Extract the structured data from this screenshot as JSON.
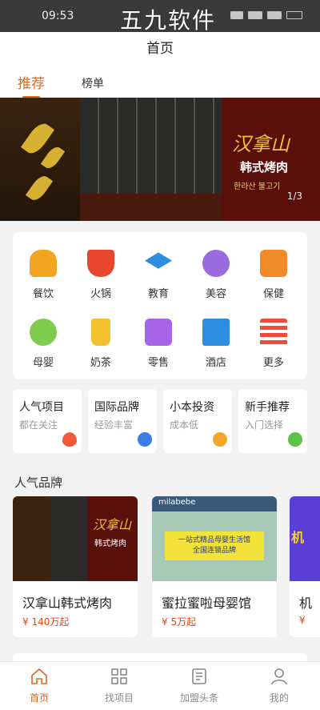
{
  "status_bar": {
    "time": "09:53",
    "watermark": "五九软件"
  },
  "header": {
    "title": "首页"
  },
  "tabs": [
    {
      "label": "推荐"
    },
    {
      "label": "榜单"
    }
  ],
  "banner": {
    "title": "汉拿山",
    "subtitle": "韩式烤肉",
    "subtitle_ko": "한라산 불고기",
    "counter": "1/3"
  },
  "categories": [
    {
      "label": "餐饮",
      "icon": "burger-icon",
      "color": "#f2a521"
    },
    {
      "label": "火锅",
      "icon": "hotpot-icon",
      "color": "#e8472d"
    },
    {
      "label": "教育",
      "icon": "graduation-cap-icon",
      "color": "#2e8de0"
    },
    {
      "label": "美容",
      "icon": "face-icon",
      "color": "#9a6bde"
    },
    {
      "label": "保健",
      "icon": "massage-icon",
      "color": "#f08a2a"
    },
    {
      "label": "母婴",
      "icon": "baby-icon",
      "color": "#7fcb4e"
    },
    {
      "label": "奶茶",
      "icon": "milk-tea-icon",
      "color": "#f4c12e"
    },
    {
      "label": "零售",
      "icon": "shopping-bag-icon",
      "color": "#a565e6"
    },
    {
      "label": "酒店",
      "icon": "hotel-icon",
      "color": "#2e8de0"
    },
    {
      "label": "更多",
      "icon": "more-grid-icon",
      "color": "#ee4b3c"
    }
  ],
  "promos": [
    {
      "title": "人气项目",
      "desc": "都在关注",
      "icon": "flame-icon",
      "color": "#f05a3a"
    },
    {
      "title": "国际品牌",
      "desc": "经验丰富",
      "icon": "globe-icon",
      "color": "#3c7ce8"
    },
    {
      "title": "小本投资",
      "desc": "成本低",
      "icon": "yen-coin-icon",
      "color": "#f4a52a"
    },
    {
      "title": "新手推荐",
      "desc": "入门选择",
      "icon": "smile-icon",
      "color": "#5cc34a"
    }
  ],
  "popular_brands": {
    "title": "人气品牌",
    "items": [
      {
        "name": "汉拿山韩式烤肉",
        "price": "¥ 140万起",
        "img_text": "汉拿山",
        "img_text2": "韩式烤肉"
      },
      {
        "name": "蜜拉蜜啦母婴馆",
        "price": "¥ 5万起",
        "img_text": "milabebe",
        "img_text2": "一站式精品母婴生活馆",
        "img_text3": "全国连锁品牌"
      },
      {
        "name": "机",
        "price": "¥",
        "img_text": "机"
      }
    ]
  },
  "tabbar": [
    {
      "label": "首页",
      "icon": "home-icon"
    },
    {
      "label": "找项目",
      "icon": "grid-icon"
    },
    {
      "label": "加盟头条",
      "icon": "news-icon"
    },
    {
      "label": "我的",
      "icon": "user-icon"
    }
  ],
  "colors": {
    "accent": "#e2661b",
    "price": "#e0461b"
  }
}
